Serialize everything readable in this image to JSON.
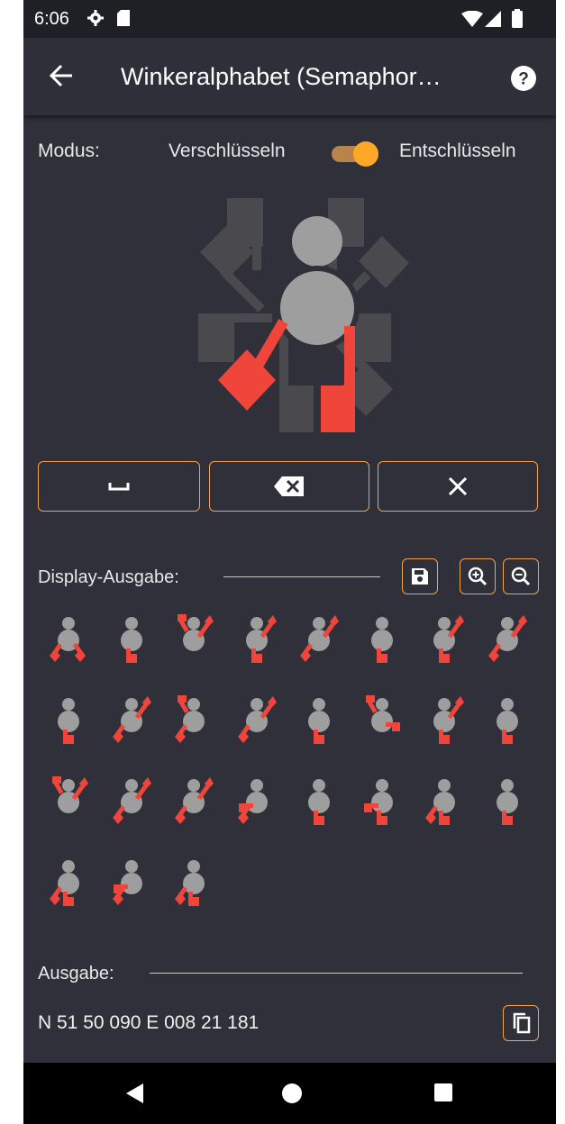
{
  "status_bar": {
    "time": "6:06",
    "icons": [
      "settings-icon",
      "sd-card-icon",
      "wifi-icon",
      "signal-icon",
      "battery-icon"
    ]
  },
  "app_bar": {
    "title": "Winkeralphabet (Semaphor…",
    "back_icon": "arrow-left-icon",
    "help_icon": "help-circle-icon"
  },
  "mode": {
    "label": "Modus:",
    "left_option": "Verschlüsseln",
    "right_option": "Entschlüsseln",
    "toggle_on": true
  },
  "semaphore": {
    "active_positions": [
      "down-left",
      "down"
    ]
  },
  "input_buttons": [
    {
      "name": "space-button",
      "icon": "space-bar-icon"
    },
    {
      "name": "backspace-button",
      "icon": "backspace-icon"
    },
    {
      "name": "clear-button",
      "icon": "close-icon"
    }
  ],
  "display": {
    "label": "Display-Ausgabe:",
    "buttons": [
      "save-icon",
      "zoom-in-icon",
      "zoom-out-icon"
    ],
    "symbols": [
      [
        "down-left",
        "down-right"
      ],
      [
        "down",
        "down"
      ],
      [
        "up-left",
        "up-right"
      ],
      [
        "up-right",
        "down"
      ],
      [
        "down-left",
        "up-right"
      ],
      [
        "down",
        "down"
      ],
      [
        "up-right",
        "down"
      ],
      [
        "down-left",
        "up-right"
      ],
      [
        "down",
        "down"
      ],
      [
        "down-left",
        "up-right"
      ],
      [
        "up-left",
        "down-left"
      ],
      [
        "down-left",
        "up-right"
      ],
      [
        "down",
        "down"
      ],
      [
        "up-left",
        "right"
      ],
      [
        "up-right",
        "down"
      ],
      [
        "down",
        "down"
      ],
      [
        "up-left",
        "up-right"
      ],
      [
        "down-left",
        "up-right"
      ],
      [
        "down-left",
        "up-right"
      ],
      [
        "left",
        "down-left"
      ],
      [
        "down",
        "down"
      ],
      [
        "left",
        "down"
      ],
      [
        "down-left",
        "down"
      ],
      [
        "down",
        "down"
      ],
      [
        "down-left",
        "down"
      ],
      [
        "left",
        "down-left"
      ],
      [
        "down-left",
        "down"
      ]
    ]
  },
  "output": {
    "label": "Ausgabe:",
    "value": "N 51 50 090 E 008 21 181",
    "copy_icon": "copy-icon"
  },
  "nav_bar": {
    "buttons": [
      "back-triangle-icon",
      "home-circle-icon",
      "recents-square-icon"
    ]
  },
  "colors": {
    "background": "#2f3039",
    "accent": "#f5a44a",
    "flag_active": "#f0453a",
    "flag_inactive": "#4a4a4e",
    "body": "#9e9e9e"
  }
}
